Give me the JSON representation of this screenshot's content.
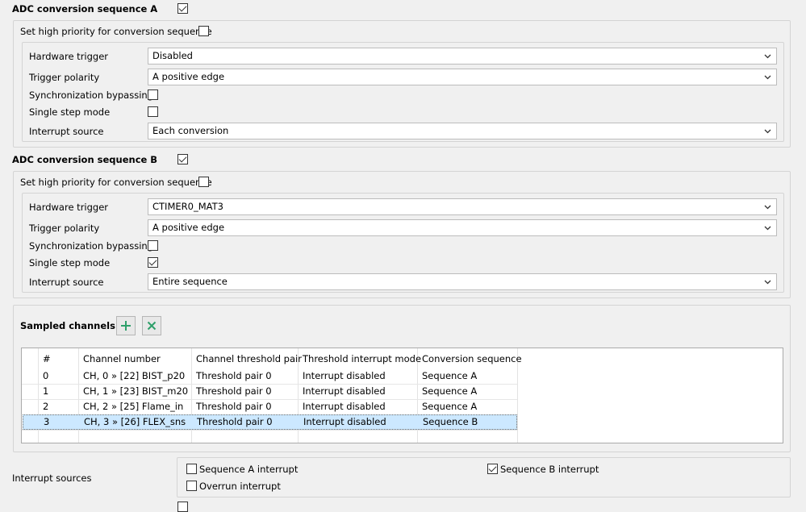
{
  "seqA": {
    "title": "ADC conversion sequence A",
    "enabled": true,
    "high_priority_label": "Set high priority for conversion sequence",
    "high_priority": false,
    "hw_trigger_label": "Hardware trigger",
    "hw_trigger_value": "Disabled",
    "polarity_label": "Trigger polarity",
    "polarity_value": "A positive edge",
    "sync_label": "Synchronization bypassing",
    "sync": false,
    "single_step_label": "Single step mode",
    "single_step": false,
    "interrupt_label": "Interrupt source",
    "interrupt_value": "Each conversion"
  },
  "seqB": {
    "title": "ADC conversion sequence B",
    "enabled": true,
    "high_priority_label": "Set high priority for conversion sequence",
    "high_priority": false,
    "hw_trigger_label": "Hardware trigger",
    "hw_trigger_value": "CTIMER0_MAT3",
    "polarity_label": "Trigger polarity",
    "polarity_value": "A positive edge",
    "sync_label": "Synchronization bypassing",
    "sync": false,
    "single_step_label": "Single step mode",
    "single_step": true,
    "interrupt_label": "Interrupt source",
    "interrupt_value": "Entire sequence"
  },
  "sampled": {
    "title": "Sampled channels",
    "add_icon": "plus-icon",
    "remove_icon": "x-icon",
    "columns": [
      "#",
      "Channel number",
      "Channel threshold pair",
      "Threshold interrupt mode",
      "Conversion sequence"
    ],
    "rows": [
      [
        "0",
        "CH, 0 » [22] BIST_p20",
        "Threshold pair 0",
        "Interrupt disabled",
        "Sequence A"
      ],
      [
        "1",
        "CH, 1 » [23] BIST_m20",
        "Threshold pair 0",
        "Interrupt disabled",
        "Sequence A"
      ],
      [
        "2",
        "CH, 2 » [25] Flame_in",
        "Threshold pair 0",
        "Interrupt disabled",
        "Sequence A"
      ],
      [
        "3",
        "CH, 3 » [26] FLEX_sns",
        "Threshold pair 0",
        "Interrupt disabled",
        "Sequence B"
      ]
    ],
    "selected_row": 3
  },
  "interrupts": {
    "label": "Interrupt sources",
    "seqA_label": "Sequence A interrupt",
    "seqA": false,
    "seqB_label": "Sequence B interrupt",
    "seqB": true,
    "overrun_label": "Overrun interrupt",
    "overrun": false
  },
  "colors": {
    "selection_bg": "#cce8ff",
    "icon_green": "#2e9f6a"
  }
}
